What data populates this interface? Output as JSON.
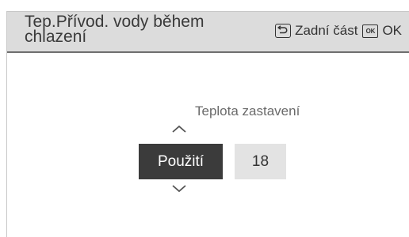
{
  "header": {
    "title": "Tep.Přívod. vody během chlazení",
    "back_label": "Zadní část",
    "ok_label": "OK",
    "ok_key_text": "OK",
    "back_icon": "return-arrow-icon"
  },
  "main": {
    "setpoint_label": "Teplota zastavení",
    "mode_value": "Použití",
    "temperature_value": "18",
    "up_icon": "chevron-up-icon",
    "down_icon": "chevron-down-icon"
  }
}
